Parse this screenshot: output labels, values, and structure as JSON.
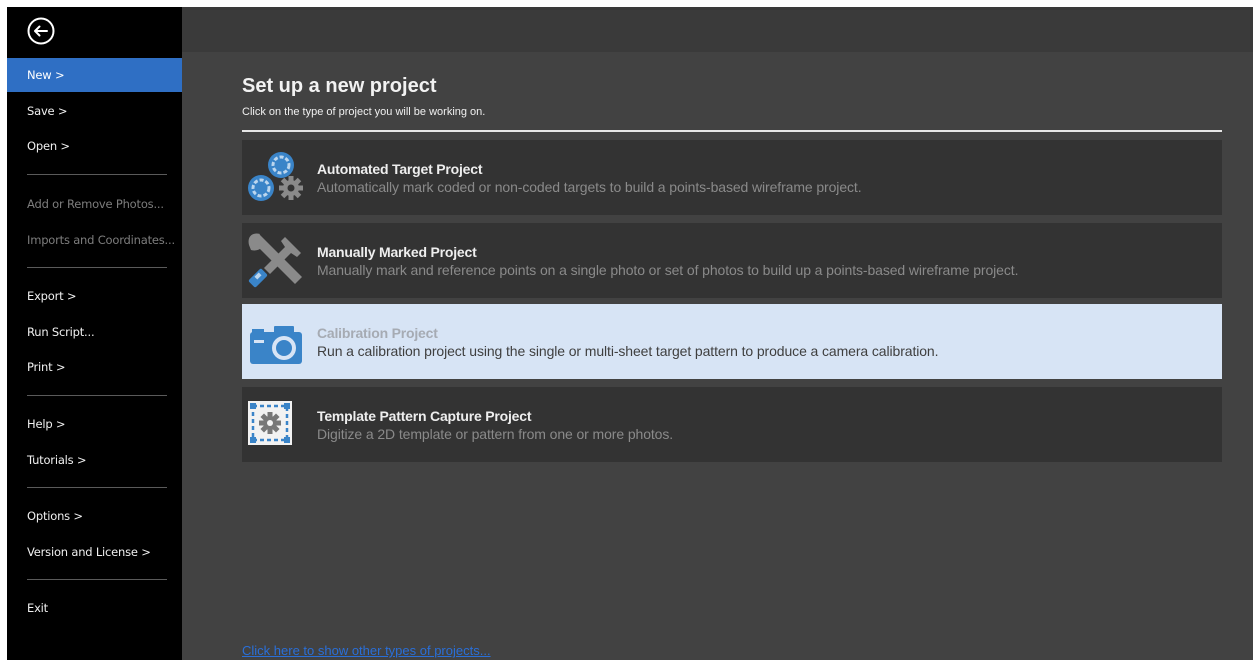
{
  "sidebar": {
    "items": [
      {
        "label": "New >",
        "state": "active"
      },
      {
        "label": "Save >",
        "state": "normal"
      },
      {
        "label": "Open >",
        "state": "normal"
      },
      {
        "label": "Add or Remove Photos...",
        "state": "disabled"
      },
      {
        "label": "Imports and Coordinates...",
        "state": "disabled"
      },
      {
        "label": "Export >",
        "state": "normal"
      },
      {
        "label": "Run Script...",
        "state": "normal"
      },
      {
        "label": "Print >",
        "state": "normal"
      },
      {
        "label": "Help >",
        "state": "normal"
      },
      {
        "label": "Tutorials >",
        "state": "normal"
      },
      {
        "label": "Options >",
        "state": "normal"
      },
      {
        "label": "Version and License >",
        "state": "normal"
      },
      {
        "label": "Exit",
        "state": "normal"
      }
    ]
  },
  "main": {
    "title": "Set up a new project",
    "subtitle": "Click on the type of project you will be working on.",
    "projects": [
      {
        "icon": "targets-icon",
        "title": "Automated Target Project",
        "description": "Automatically mark coded or non-coded targets to build a points-based wireframe project."
      },
      {
        "icon": "tools-icon",
        "title": "Manually Marked Project",
        "description": "Manually mark and reference points on a single photo or set of photos to build up a points-based wireframe project."
      },
      {
        "icon": "camera-icon",
        "title": "Calibration Project",
        "description": "Run a calibration project using the single or multi-sheet target pattern to produce a camera calibration.",
        "selected": true
      },
      {
        "icon": "template-icon",
        "title": "Template Pattern Capture Project",
        "description": "Digitize a 2D template or pattern from one or more photos."
      }
    ],
    "more_link": "Click here to show other types of projects..."
  },
  "colors": {
    "accent": "#2f6fc4",
    "selected_card": "#d7e4f5",
    "icon_blue": "#3a84c8",
    "link": "#2a6fd8"
  }
}
